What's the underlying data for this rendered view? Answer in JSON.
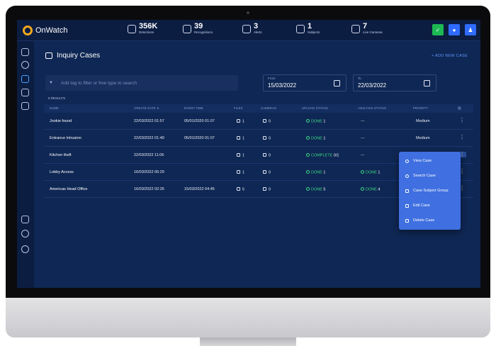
{
  "app": {
    "name": "OnWatch"
  },
  "stats": [
    {
      "icon": "detections-icon",
      "value": "356K",
      "label": "Detections"
    },
    {
      "icon": "recognitions-icon",
      "value": "39",
      "label": "Recognitions"
    },
    {
      "icon": "alerts-icon",
      "value": "3",
      "label": "Alerts"
    },
    {
      "icon": "subjects-icon",
      "value": "1",
      "label": "Subjects"
    },
    {
      "icon": "cameras-icon",
      "value": "7",
      "label": "Live Cameras"
    }
  ],
  "top_buttons": [
    {
      "icon": "status-check-icon",
      "color": "#1db954"
    },
    {
      "icon": "bell-icon",
      "color": "#2f6bff"
    },
    {
      "icon": "user-icon",
      "color": "#2f6bff"
    }
  ],
  "page": {
    "title": "Inquiry Cases",
    "add_case": "+ ADD NEW CASE",
    "search_placeholder": "Add tag to filter or free type to search",
    "from_label": "From",
    "from_value": "15/03/2022",
    "to_label": "To",
    "to_value": "22/03/2022",
    "results": "5 RESULTS"
  },
  "columns": [
    "NAME",
    "CREATE DATE ⬇",
    "EVENT TIME",
    "FILES",
    "CAMERAS",
    "UPLOAD STATUS",
    "ANALYSIS STATUS",
    "PRIORITY"
  ],
  "rows": [
    {
      "name": "Jookie found",
      "create": "22/03/2022 01:57",
      "event": "05/01/2020 01:07",
      "files": "1",
      "cameras": "0",
      "upload": "DONE",
      "upload_n": "1",
      "analysis": "---",
      "analysis_n": "",
      "priority": "Medium"
    },
    {
      "name": "Entrance Intrusion",
      "create": "22/03/2022 01:49",
      "event": "05/01/2020 01:07",
      "files": "1",
      "cameras": "0",
      "upload": "DONE",
      "upload_n": "1",
      "analysis": "---",
      "analysis_n": "",
      "priority": "Medium"
    },
    {
      "name": "Kitchen theft",
      "create": "22/03/2022 11:06",
      "event": "",
      "files": "1",
      "cameras": "0",
      "upload": "COMPLETE",
      "upload_n": "0/1",
      "analysis": "---",
      "analysis_n": "",
      "priority": ""
    },
    {
      "name": "Lobby Access",
      "create": "16/03/2022 05:29",
      "event": "",
      "files": "1",
      "cameras": "0",
      "upload": "DONE",
      "upload_n": "1",
      "analysis": "DONE",
      "analysis_n": "1",
      "priority": ""
    },
    {
      "name": "Americas Head Office",
      "create": "16/03/2022 02:26",
      "event": "15/03/2022 04:45",
      "files": "5",
      "cameras": "0",
      "upload": "DONE",
      "upload_n": "5",
      "analysis": "DONE",
      "analysis_n": "4",
      "priority": ""
    }
  ],
  "menu": [
    {
      "icon": "view-icon",
      "label": "View Case"
    },
    {
      "icon": "search-icon",
      "label": "Search Case"
    },
    {
      "icon": "group-icon",
      "label": "Case Subject Group"
    },
    {
      "icon": "edit-icon",
      "label": "Edit Case"
    },
    {
      "icon": "trash-icon",
      "label": "Delete Case"
    }
  ]
}
